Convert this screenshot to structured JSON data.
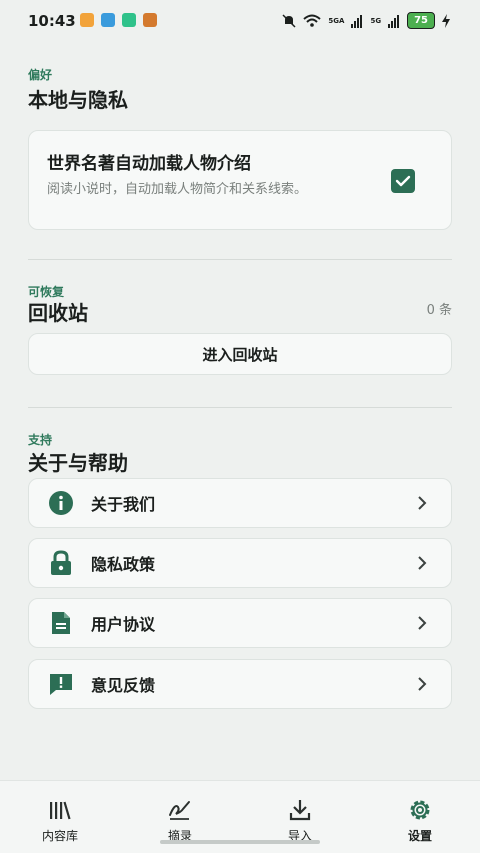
{
  "status_bar": {
    "time": "10:43",
    "battery": "75",
    "signal_1": "5GA",
    "signal_2": "5G"
  },
  "preferences": {
    "label": "偏好",
    "title": "本地与隐私",
    "auto_load": {
      "title": "世界名著自动加载人物介绍",
      "description": "阅读小说时，自动加载人物简介和关系线索。",
      "checked": true
    }
  },
  "recycle": {
    "label": "可恢复",
    "title": "回收站",
    "count": "0 条",
    "button": "进入回收站"
  },
  "support": {
    "label": "支持",
    "title": "关于与帮助",
    "items": [
      {
        "label": "关于我们",
        "icon": "info-icon"
      },
      {
        "label": "隐私政策",
        "icon": "lock-icon"
      },
      {
        "label": "用户协议",
        "icon": "document-icon"
      },
      {
        "label": "意见反馈",
        "icon": "feedback-icon"
      }
    ]
  },
  "bottom_nav": {
    "items": [
      {
        "label": "内容库",
        "icon": "library-icon",
        "active": false
      },
      {
        "label": "摘录",
        "icon": "excerpt-icon",
        "active": false
      },
      {
        "label": "导入",
        "icon": "import-icon",
        "active": false
      },
      {
        "label": "设置",
        "icon": "settings-icon",
        "active": true
      }
    ]
  },
  "colors": {
    "accent": "#2c6e55",
    "background": "#eef1ef"
  }
}
